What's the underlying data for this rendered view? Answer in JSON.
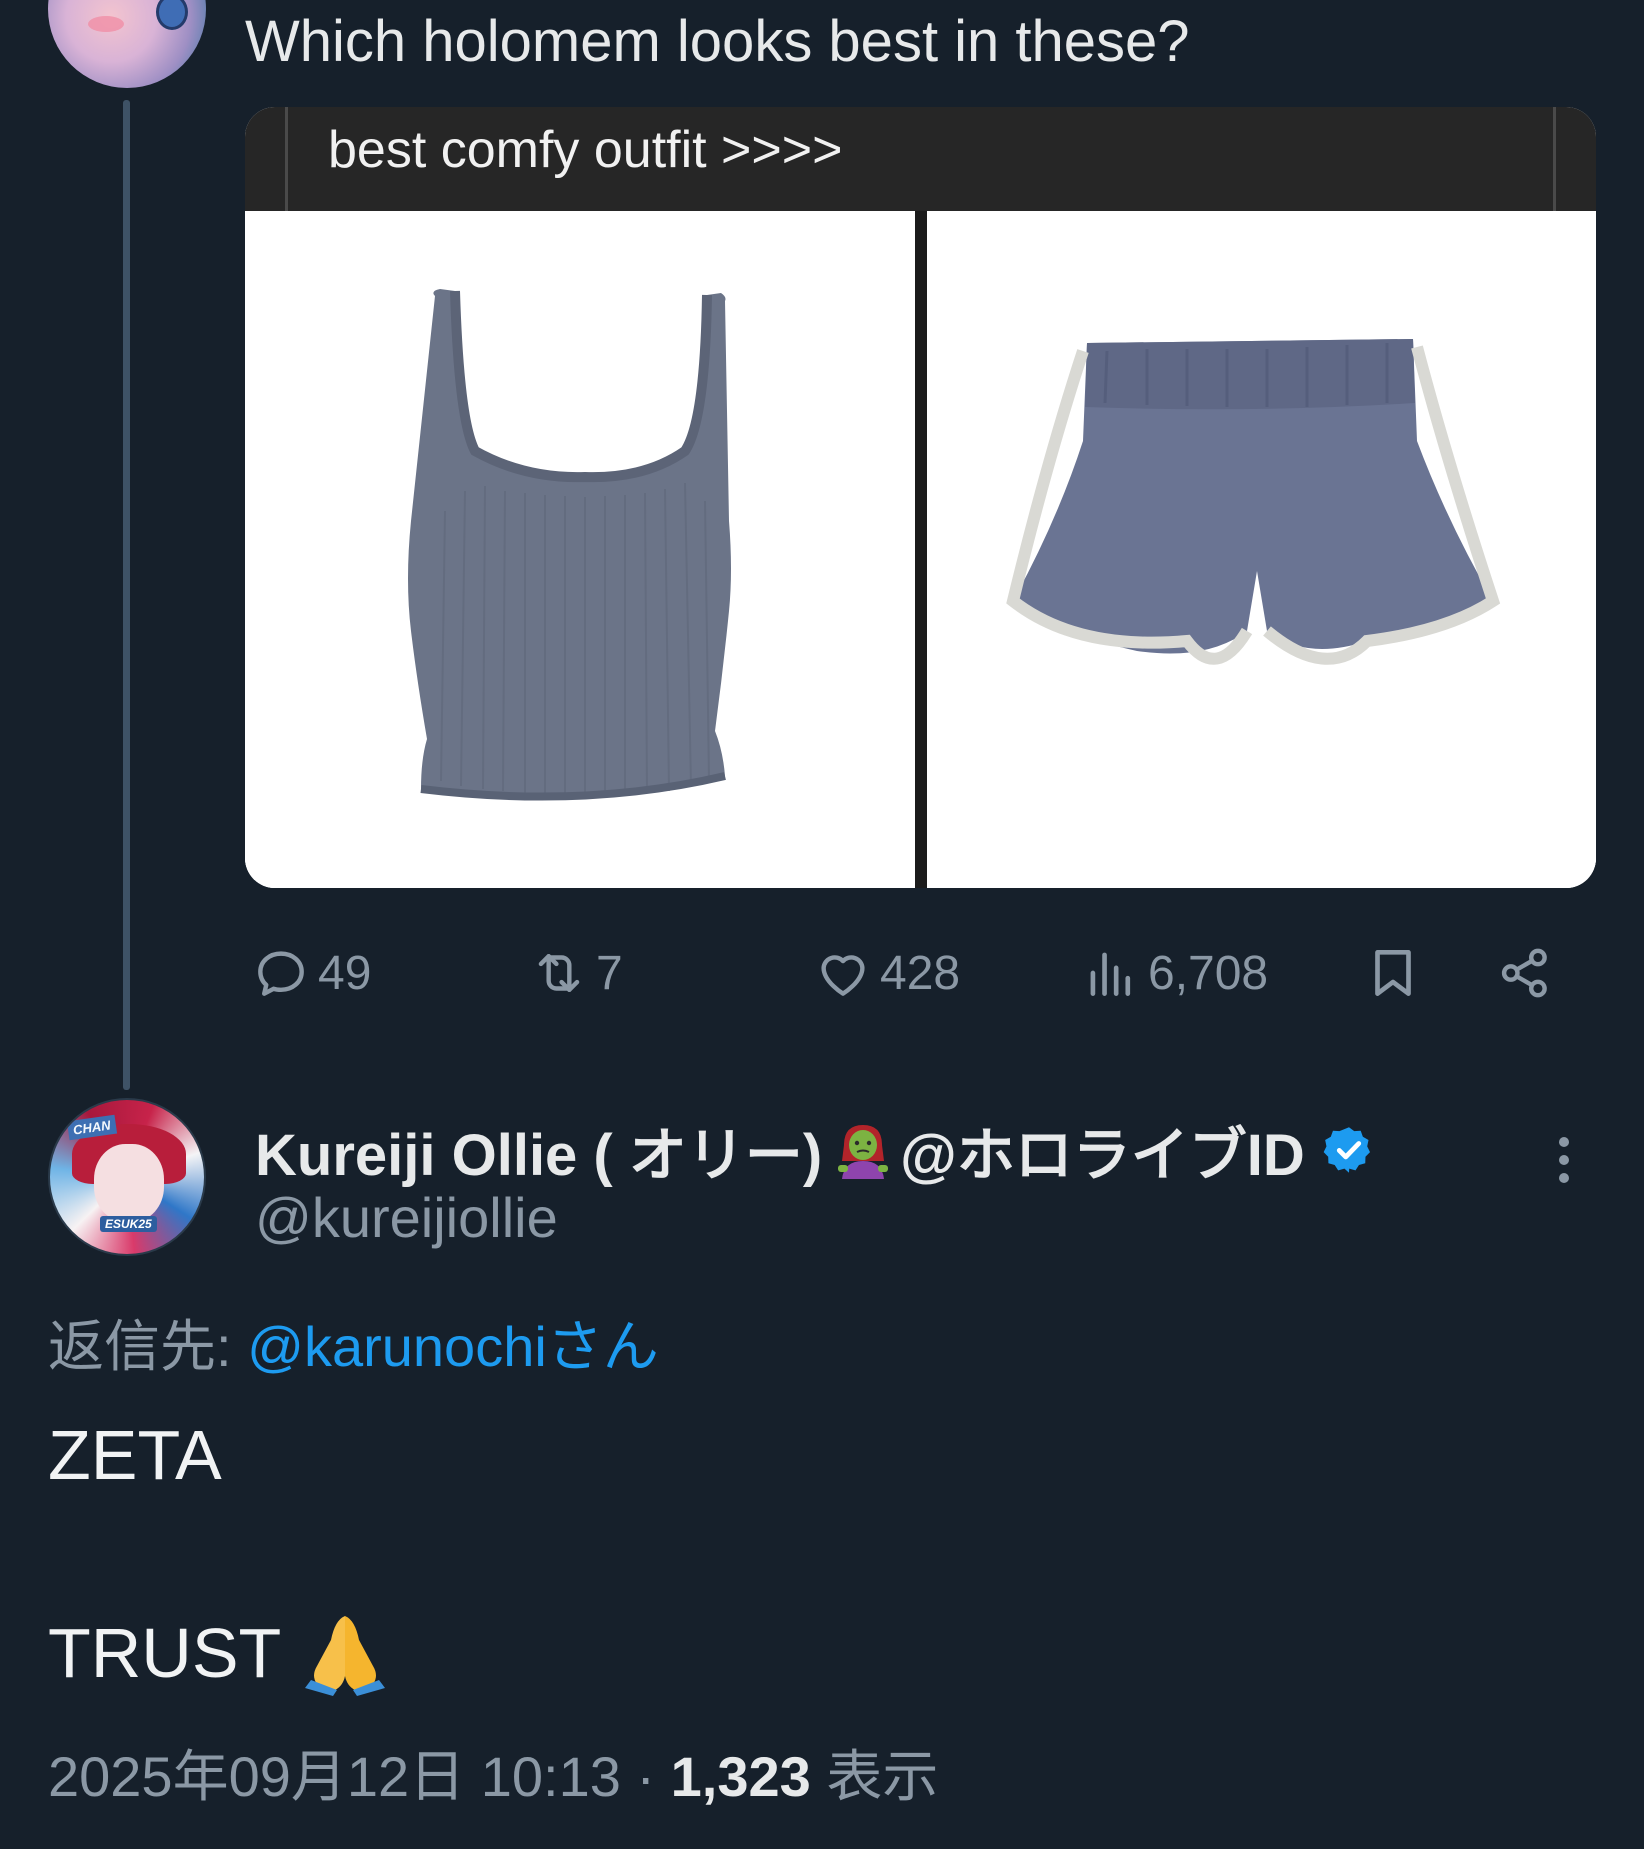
{
  "parent_tweet": {
    "text": "Which holomem looks best in these?",
    "media_caption": "best comfy outfit >>>>",
    "media": [
      {
        "name": "tank-top-image"
      },
      {
        "name": "shorts-image"
      }
    ],
    "actions": {
      "reply_count": "49",
      "repost_count": "7",
      "like_count": "428",
      "view_count": "6,708"
    }
  },
  "reply": {
    "author_name": "Kureiji Ollie ( オリー)",
    "author_suffix": "@ホロライブID",
    "author_handle": "@kureijiollie",
    "reply_to_label": "返信先: ",
    "reply_to_handle": "@karunochiさん",
    "body_line_1": "ZETA",
    "body_line_2": "TRUST",
    "timestamp": "2025年09月12日 10:13 · ",
    "views_count": "1,323",
    "views_label": " 表示"
  },
  "colors": {
    "background": "#16202b",
    "link": "#1d9bf0",
    "muted": "#8b98a5",
    "verified": "#1d9bf0"
  }
}
